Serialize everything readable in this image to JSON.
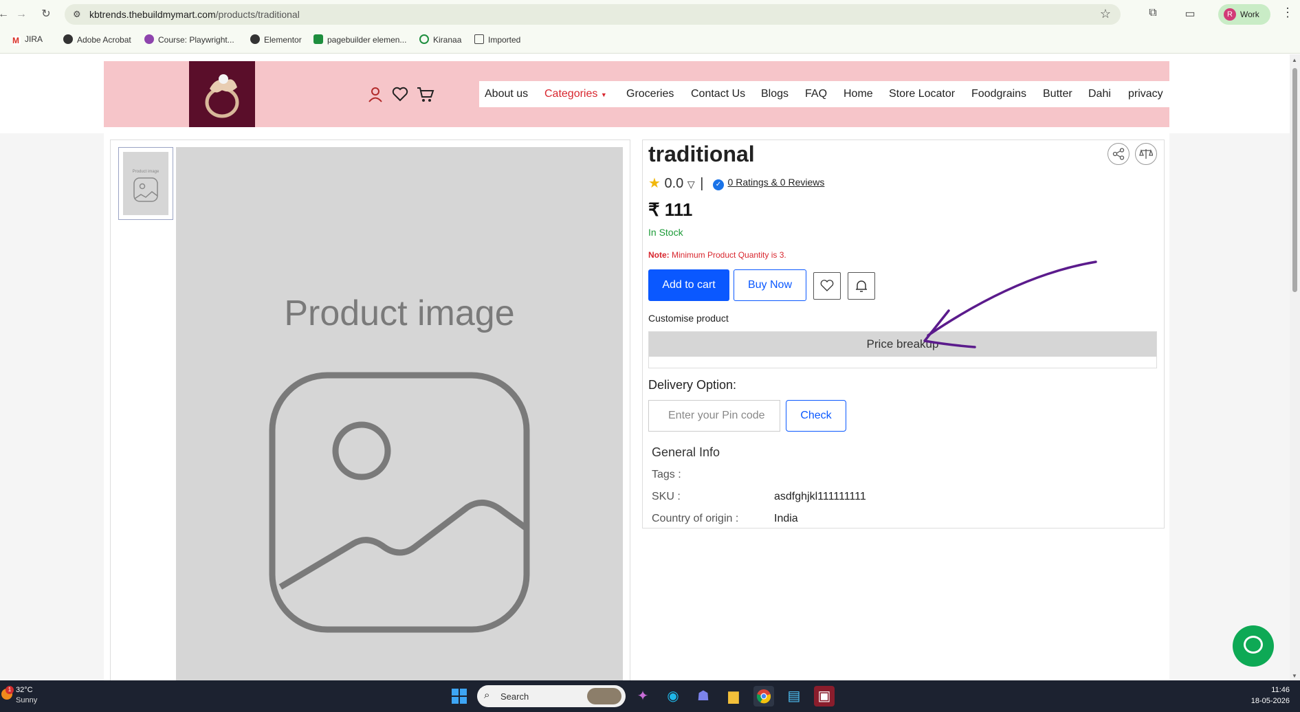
{
  "browser": {
    "url_host": "kbtrends.thebuildmymart.com",
    "url_path": "/products/traditional",
    "profile_initial": "R",
    "profile_label": "Work",
    "bookmarks": [
      "JIRA",
      "Adobe Acrobat",
      "Course: Playwright...",
      "Elementor",
      "pagebuilder elemen...",
      "Kiranaa",
      "Imported"
    ]
  },
  "header": {
    "menu": [
      "About us",
      "Categories",
      "Groceries",
      "Contact Us",
      "Blogs",
      "FAQ",
      "Home",
      "Store Locator",
      "Foodgrains",
      "Butter",
      "Dahi",
      "privacy"
    ],
    "active_menu": "Categories",
    "brand_color": "#f6c5c9",
    "accent_color": "#d8262e"
  },
  "gallery": {
    "placeholder_text": "Product image",
    "thumb_text": "Product image"
  },
  "product": {
    "title": "traditional",
    "rating": "0.0",
    "ratings_link": "0 Ratings  & 0 Reviews",
    "price": "₹ 111",
    "stock": "In Stock",
    "note_label": "Note:",
    "note_text": " Minimum Product Quantity is 3.",
    "add_to_cart": "Add to cart",
    "buy_now": "Buy Now",
    "customise": "Customise product",
    "price_breakup": "Price breakup",
    "delivery_label": "Delivery Option:",
    "pin_placeholder": "Enter your Pin code",
    "check": "Check",
    "general_info_title": "General Info",
    "general_info": [
      {
        "label": "Tags :",
        "value": ""
      },
      {
        "label": "SKU :",
        "value": "asdfghjkl111111111"
      },
      {
        "label": "Country of origin :",
        "value": "India"
      }
    ]
  },
  "taskbar": {
    "temperature": "32°C",
    "weather": "Sunny",
    "weather_badge": "1",
    "search_label": "Search",
    "time": "11:46",
    "date": "18-05-2026"
  }
}
